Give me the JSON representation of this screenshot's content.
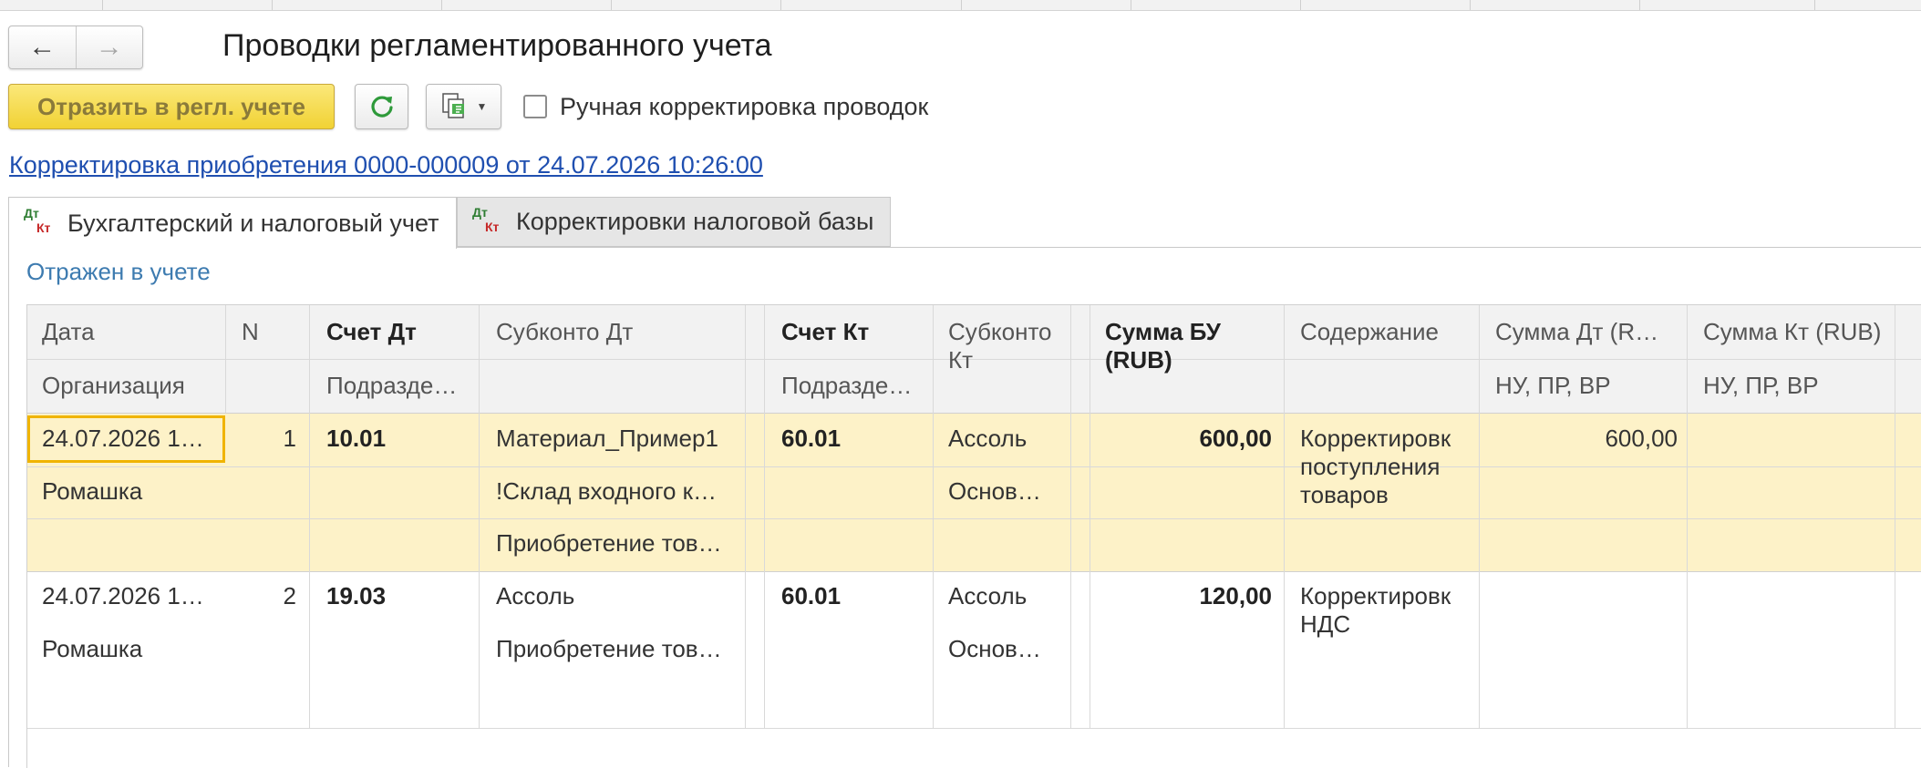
{
  "window": {
    "title": "Проводки регламентированного учета"
  },
  "nav": {
    "back_icon": "←",
    "forward_icon": "→"
  },
  "toolbar": {
    "post_label": "Отразить в регл. учете",
    "manual_correction_label": "Ручная корректировка проводок",
    "manual_correction_checked": false
  },
  "document_link": "Корректировка приобретения 0000-000009 от 24.07.2026 10:26:00",
  "tabs": [
    {
      "label": "Бухгалтерский и налоговый учет",
      "icon_top": "Дт",
      "icon_bottom": "Кт"
    },
    {
      "label": "Корректировки налоговой базы",
      "icon_top": "Дт",
      "icon_bottom": "Кт"
    }
  ],
  "status_text": "Отражен в учете",
  "columns": {
    "date": "Дата",
    "n": "N",
    "account_dt": "Счет Дт",
    "subconto_dt": "Субконто Дт",
    "account_kt": "Счет Кт",
    "subconto_kt": "Субконто Кт",
    "amount_bu": "Сумма БУ (RUB)",
    "content": "Содержание",
    "amount_dt": "Сумма Дт (R…",
    "amount_kt": "Сумма Кт (RUB)",
    "organization": "Организация",
    "division_dt": "Подразде…",
    "division_kt": "Подразде…",
    "tax_dt": "НУ, ПР, ВР",
    "tax_kt": "НУ, ПР, ВР"
  },
  "rows": [
    {
      "date": "24.07.2026 1…",
      "n": "1",
      "account_dt": "10.01",
      "organization": "Ромашка",
      "subconto_dt": [
        "Материал_Пример1",
        "!Склад входного к…",
        "Приобретение тов…"
      ],
      "account_kt": "60.01",
      "subconto_kt": [
        "Ассоль",
        "Основ…"
      ],
      "amount_bu": "600,00",
      "content": "Корректировк поступления товаров",
      "amount_dt": "600,00"
    },
    {
      "date": "24.07.2026 1…",
      "n": "2",
      "account_dt": "19.03",
      "organization": "Ромашка",
      "subconto_dt": [
        "Ассоль",
        "Приобретение тов…"
      ],
      "account_kt": "60.01",
      "subconto_kt": [
        "Ассоль",
        "Основ…"
      ],
      "amount_bu": "120,00",
      "content": "Корректировк НДС"
    }
  ]
}
